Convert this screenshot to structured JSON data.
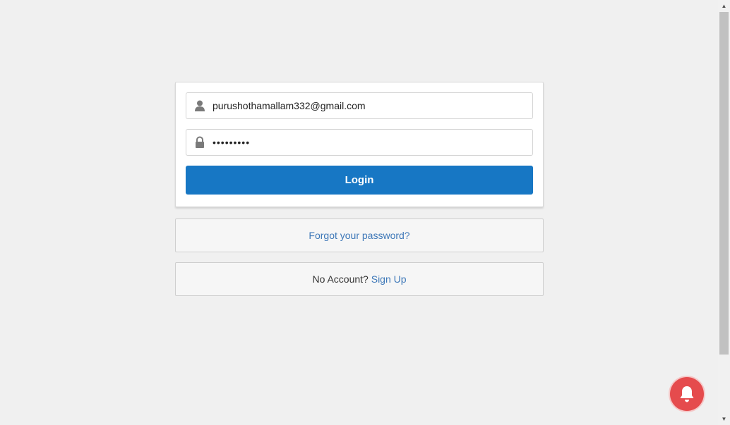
{
  "login_form": {
    "email": {
      "value": "purushothamallam332@gmail.com",
      "icon": "user-icon"
    },
    "password": {
      "value": "•••••••••",
      "icon": "lock-icon"
    },
    "login_label": "Login"
  },
  "forgot": {
    "link_label": "Forgot your password?"
  },
  "signup": {
    "prompt": "No Account?",
    "link_label": "Sign Up"
  },
  "notification": {
    "icon": "bell-icon"
  },
  "colors": {
    "primary": "#1777c4",
    "link": "#3e78b8",
    "bell": "#e54b4d",
    "background": "#f0f0f0"
  }
}
